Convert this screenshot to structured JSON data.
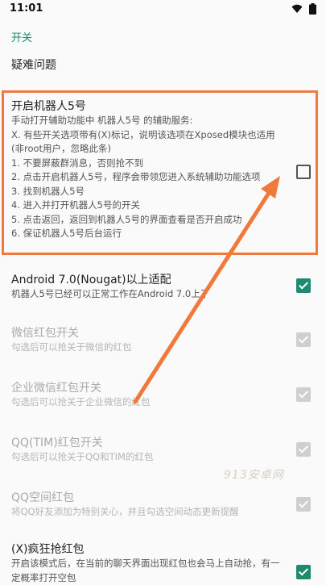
{
  "status_bar": {
    "time": "11:01",
    "icons": [
      "wifi-icon",
      "battery-icon"
    ]
  },
  "sections": {
    "switches_header": "开关",
    "troubleshooting": "疑难问题"
  },
  "accessibility": {
    "title": "开启机器人5号",
    "lines": [
      "手动打开辅助功能中 机器人5号 的辅助服务:",
      "X. 有些开关选项带有(X)标记，说明该选项在Xposed模块也适用",
      "(非root用户，忽略此条)",
      "1. 不要屏蔽群消息，否则抢不到",
      "2. 点击开启机器人5号，程序会带领您进入系统辅助功能选项",
      "3. 找到机器人5号",
      "4. 进入并打开机器人5号的开关",
      "5. 点击返回，返回到机器人5号的界面查看是否开启成功",
      "6. 保证机器人5号后台运行"
    ],
    "checked": false
  },
  "prefs": [
    {
      "title": "Android 7.0(Nougat)以上适配",
      "summary": "机器人5号已经可以正常工作在Android 7.0上了",
      "checked": true,
      "enabled": true
    },
    {
      "title": "微信红包开关",
      "summary": "勾选后可以抢关于微信的红包",
      "checked": true,
      "enabled": false
    },
    {
      "title": "企业微信红包开关",
      "summary": "勾选后可以抢关于企业微信的红包",
      "checked": true,
      "enabled": false
    },
    {
      "title": "QQ(TIM)红包开关",
      "summary": "勾选后可以抢关于QQ和TIM的红包",
      "checked": true,
      "enabled": false
    },
    {
      "title": "QQ空间红包",
      "summary": "将QQ好友添加为特别关心，并且勾选空间动态更新提醒",
      "checked": true,
      "enabled": false
    },
    {
      "title": "(X)疯狂抢红包",
      "summary": "开启该模式后，在当前的聊天界面出现红包也会马上自动抢，有一定概率打开空包",
      "checked": true,
      "enabled": true
    }
  ],
  "watermark": "913安卓网",
  "colors": {
    "accent": "#1f8a70",
    "highlight": "#f07a3c"
  }
}
